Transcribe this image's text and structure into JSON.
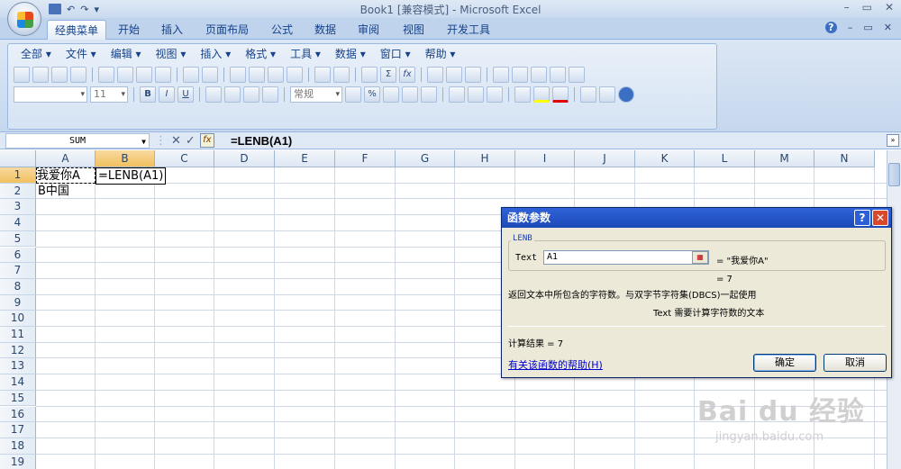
{
  "window": {
    "title": "Book1  [兼容模式] - Microsoft Excel",
    "controls": [
      "–",
      "▭",
      "✕"
    ]
  },
  "qat": {
    "undo": "↶",
    "redo": "↷",
    "customize": "▾"
  },
  "ribbon_tabs": [
    {
      "label": "经典菜单",
      "active": true
    },
    {
      "label": "开始"
    },
    {
      "label": "插入"
    },
    {
      "label": "页面布局"
    },
    {
      "label": "公式"
    },
    {
      "label": "数据"
    },
    {
      "label": "审阅"
    },
    {
      "label": "视图"
    },
    {
      "label": "开发工具"
    }
  ],
  "ribbon_right": [
    "?",
    "–",
    "▭",
    "✕"
  ],
  "menu": [
    "全部 ▾",
    "文件 ▾",
    "编辑 ▾",
    "视图 ▾",
    "插入 ▾",
    "格式 ▾",
    "工具 ▾",
    "数据 ▾",
    "窗口 ▾",
    "帮助 ▾"
  ],
  "toolbar": {
    "font_size": "11",
    "number_format": "常规",
    "sum_symbol": "Σ",
    "fx_symbol": "fx",
    "bold": "B",
    "italic": "I",
    "underline": "U",
    "percent": "%"
  },
  "formula_bar": {
    "name_box": "SUM",
    "cancel": "✕",
    "enter": "✓",
    "fx": "fx",
    "formula": "=LENB(A1)",
    "expand": "»"
  },
  "sheet": {
    "columns": [
      "A",
      "B",
      "C",
      "D",
      "E",
      "F",
      "G",
      "H",
      "I",
      "J",
      "K",
      "L",
      "M",
      "N"
    ],
    "selected_column": "B",
    "rows": [
      "1",
      "2",
      "3",
      "4",
      "5",
      "6",
      "7",
      "8",
      "9",
      "10",
      "11",
      "12",
      "13",
      "14",
      "15",
      "16",
      "17",
      "18",
      "19"
    ],
    "selected_row": "1",
    "cells": {
      "A1": "我爱你A",
      "B1": "=LENB(A1)",
      "A2": "B中国"
    }
  },
  "dialog": {
    "title": "函数参数",
    "help_glyph": "?",
    "close_glyph": "✕",
    "function_name": "LENB",
    "arg_label": "Text",
    "arg_value": "A1",
    "arg_result": "= \"我爱你A\"",
    "ref_glyph": "▦",
    "result_line": "= 7",
    "description": "返回文本中所包含的字符数。与双字节字符集(DBCS)一起使用",
    "arg_description": "Text  需要计算字符数的文本",
    "calc_result": "计算结果 =  7",
    "help_link": "有关该函数的帮助(H)",
    "ok": "确定",
    "cancel": "取消"
  },
  "watermark": {
    "brand": "Bai du 经验",
    "url": "jingyan.baidu.com"
  }
}
